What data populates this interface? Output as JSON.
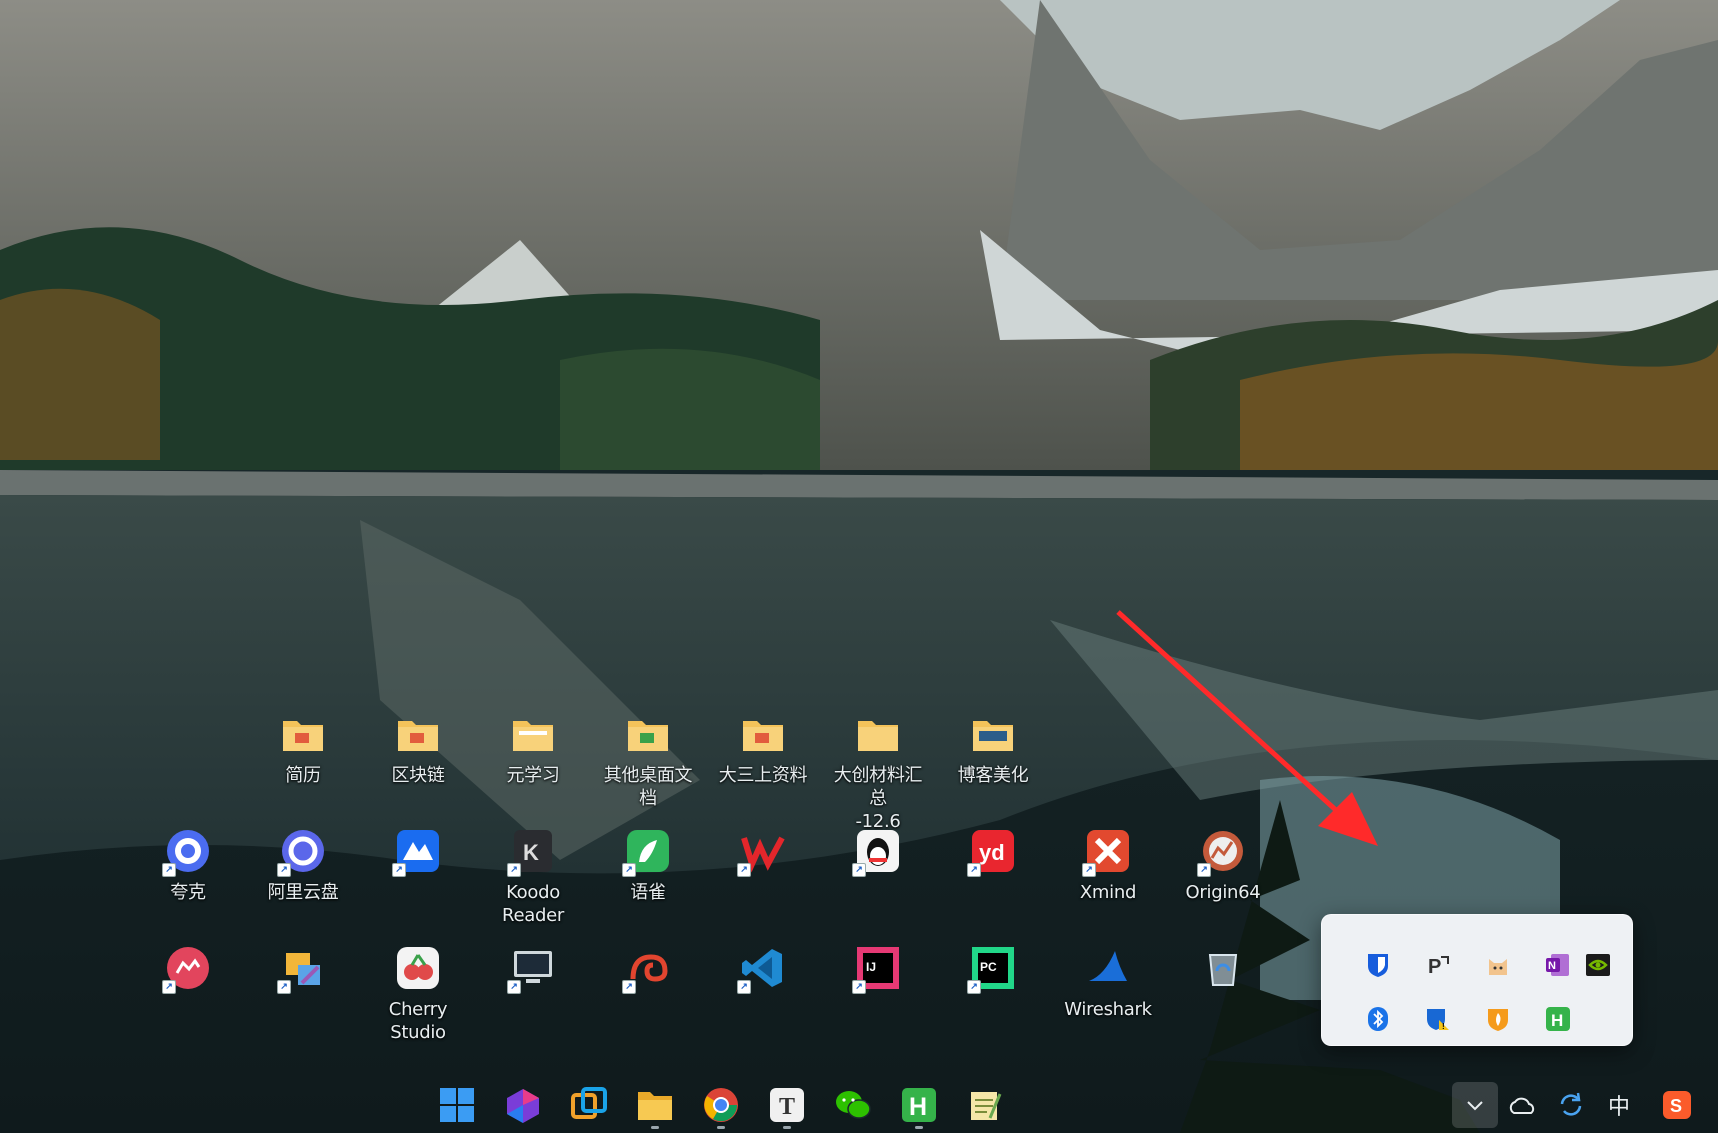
{
  "desktop": {
    "folders": [
      {
        "label": "简历",
        "icon": "folder-icon"
      },
      {
        "label": "区块链",
        "icon": "folder-icon"
      },
      {
        "label": "元学习",
        "icon": "folder-icon"
      },
      {
        "label": "其他桌面文档",
        "icon": "folder-icon"
      },
      {
        "label": "大三上资料",
        "icon": "folder-icon"
      },
      {
        "label": "大创材料汇总\n-12.6",
        "icon": "folder-icon"
      },
      {
        "label": "博客美化",
        "icon": "folder-icon"
      }
    ],
    "apps_row2": [
      {
        "label": "夸克",
        "icon": "quark-icon"
      },
      {
        "label": "阿里云盘",
        "icon": "aliyun-drive-icon"
      },
      {
        "label": "",
        "icon": "baidu-netdisk-icon"
      },
      {
        "label": "Koodo\nReader",
        "icon": "koodo-reader-icon"
      },
      {
        "label": "语雀",
        "icon": "yuque-icon"
      },
      {
        "label": "",
        "icon": "wps-icon"
      },
      {
        "label": "",
        "icon": "qq-icon"
      },
      {
        "label": "",
        "icon": "youdao-icon"
      },
      {
        "label": "Xmind",
        "icon": "xmind-icon"
      },
      {
        "label": "Origin64",
        "icon": "origin-icon"
      }
    ],
    "apps_row3": [
      {
        "label": "",
        "icon": "screen-record-icon"
      },
      {
        "label": "",
        "icon": "tools-icon"
      },
      {
        "label": "Cherry\nStudio",
        "icon": "cherry-studio-icon"
      },
      {
        "label": "",
        "icon": "this-pc-icon"
      },
      {
        "label": "",
        "icon": "snail-icon"
      },
      {
        "label": "",
        "icon": "vscode-icon"
      },
      {
        "label": "",
        "icon": "intellij-icon"
      },
      {
        "label": "",
        "icon": "pycharm-icon"
      },
      {
        "label": "Wireshark",
        "icon": "wireshark-icon"
      },
      {
        "label": "",
        "icon": "recycle-bin-icon"
      }
    ]
  },
  "taskbar": {
    "pinned": [
      "windows-start-icon",
      "visual-studio-icon",
      "remote-desktop-icon",
      "file-explorer-icon",
      "chrome-icon",
      "typora-icon",
      "wechat-icon",
      "h-app-icon",
      "notepad-icon"
    ],
    "tray": {
      "overflow_chevron": "chevron-down-icon",
      "cloud": "onedrive-icon",
      "sync": "sync-icon",
      "ime_label": "中",
      "sogou": "sogou-icon"
    }
  },
  "tray_flyout": {
    "items": [
      "bitwarden-icon",
      "pp-icon",
      "cat-icon",
      "onenote-icon",
      "nvidia-icon",
      "bluetooth-icon",
      "windows-security-icon",
      "huorong-icon",
      "h-green-icon"
    ]
  },
  "colors": {
    "accent_red": "#ff2a2a",
    "taskbar_text": "#e9eef0",
    "flyout_bg": "#eef1f4"
  }
}
